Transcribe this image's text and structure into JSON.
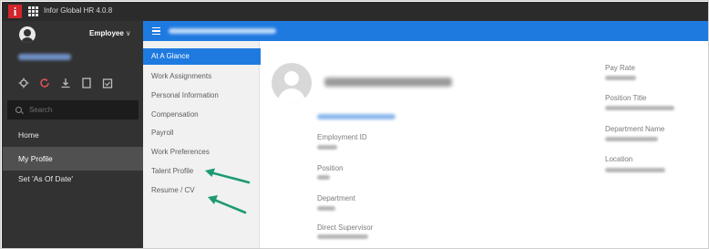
{
  "topbar": {
    "logo": "i",
    "app_title": "Infor Global HR 4.0.8"
  },
  "sidebar": {
    "role_label": "Employee",
    "role_chevron": "∨",
    "search_placeholder": "Search",
    "nav_items": [
      {
        "label": "Home",
        "active": false
      },
      {
        "label": "My Profile",
        "active": true
      },
      {
        "label": "Set 'As Of Date'",
        "active": false
      }
    ],
    "quick_icons": [
      "settings-icon",
      "refresh-icon",
      "download-icon",
      "document-icon",
      "calendar-icon"
    ]
  },
  "submenu": {
    "items": [
      {
        "label": "At A Glance",
        "active": true
      },
      {
        "label": "Work Assignments",
        "active": false
      },
      {
        "label": "Personal Information",
        "active": false
      },
      {
        "label": "Compensation",
        "active": false
      },
      {
        "label": "Payroll",
        "active": false
      },
      {
        "label": "Work Preferences",
        "active": false
      },
      {
        "label": "Talent Profile",
        "active": false
      },
      {
        "label": "Resume / CV",
        "active": false
      }
    ]
  },
  "profile": {
    "fields_left": [
      {
        "label": "Employment ID"
      },
      {
        "label": "Position"
      },
      {
        "label": "Department"
      },
      {
        "label": "Direct Supervisor"
      }
    ],
    "fields_right": [
      {
        "label": "Pay Rate"
      },
      {
        "label": "Position Title"
      },
      {
        "label": "Department Name"
      },
      {
        "label": "Location"
      }
    ]
  },
  "colors": {
    "accent": "#1f7ae0",
    "sidebar_bg": "#323232",
    "topbar_bg": "#2b2b2b",
    "annotation_arrow": "#1e9a74"
  }
}
